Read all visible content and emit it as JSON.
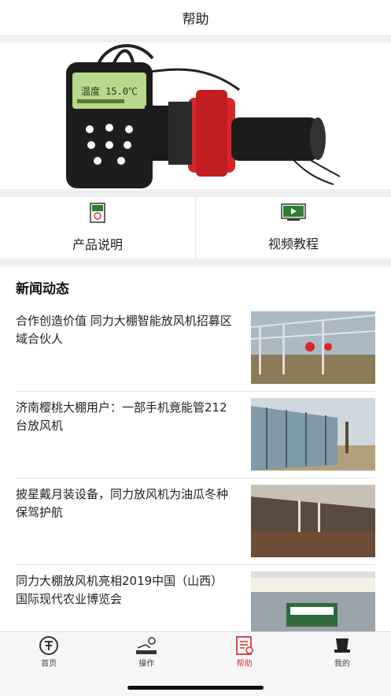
{
  "header": {
    "title": "帮助"
  },
  "banner": {
    "device_screen": "温度 15.0℃"
  },
  "shortcuts": [
    {
      "label": "产品说明",
      "icon": "document-icon"
    },
    {
      "label": "视频教程",
      "icon": "video-icon"
    }
  ],
  "news": {
    "title": "新闻动态",
    "items": [
      {
        "title": "合作创造价值 同力大棚智能放风机招募区域合伙人"
      },
      {
        "title": "济南樱桃大棚用户：一部手机竟能管212台放风机"
      },
      {
        "title": "披星戴月装设备，同力放风机为油瓜冬种保驾护航"
      },
      {
        "title": "同力大棚放风机亮相2019中国（山西）国际现代农业博览会"
      }
    ]
  },
  "tabbar": {
    "items": [
      {
        "label": "首页",
        "icon": "home-logo-icon",
        "active": false
      },
      {
        "label": "操作",
        "icon": "operation-icon",
        "active": false
      },
      {
        "label": "帮助",
        "icon": "help-icon",
        "active": true
      },
      {
        "label": "我的",
        "icon": "profile-icon",
        "active": false
      }
    ],
    "accent_color": "#d9363b"
  }
}
